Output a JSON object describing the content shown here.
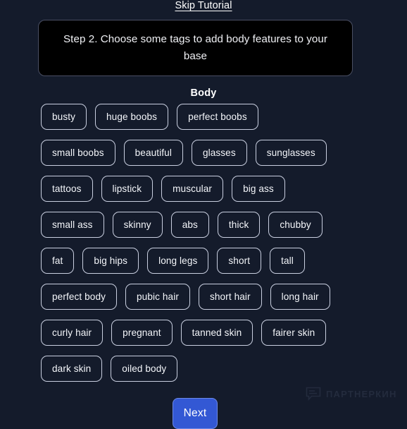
{
  "app": {
    "background_color": "#141b2b",
    "accent_color": "#3358d4",
    "pill_border_color": "#c9cfe0"
  },
  "skip": {
    "label": "Skip Tutorial"
  },
  "tutorial": {
    "text": "Step 2. Choose some tags to add body features to your base"
  },
  "section": {
    "title": "Body"
  },
  "tag_rows": [
    [
      "busty",
      "huge boobs",
      "perfect boobs"
    ],
    [
      "small boobs",
      "beautiful",
      "glasses",
      "sunglasses"
    ],
    [
      "tattoos",
      "lipstick",
      "muscular",
      "big ass"
    ],
    [
      "small ass",
      "skinny",
      "abs",
      "thick",
      "chubby"
    ],
    [
      "fat",
      "big hips",
      "long legs",
      "short",
      "tall"
    ],
    [
      "perfect body",
      "pubic hair",
      "short hair",
      "long hair"
    ],
    [
      "curly hair",
      "pregnant",
      "tanned skin",
      "fairer skin"
    ],
    [
      "dark skin",
      "oiled body"
    ]
  ],
  "footer": {
    "next_label": "Next"
  },
  "watermark": {
    "text": "ПАРТНЕРКИН",
    "icon": "chat-bubble-icon",
    "color": "#232b3d"
  }
}
